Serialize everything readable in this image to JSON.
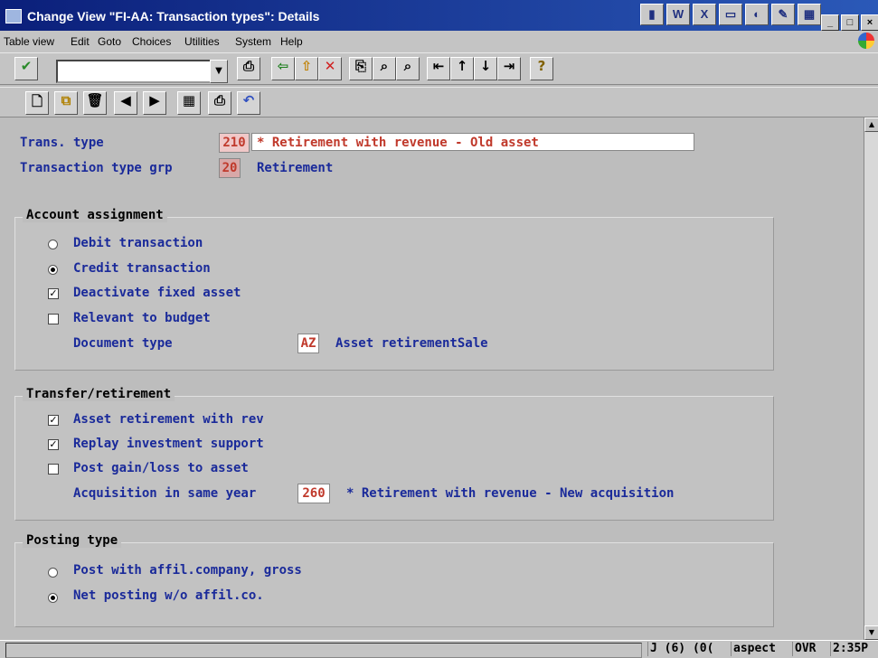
{
  "window": {
    "title": "Change View \"FI-AA: Transaction types\": Details"
  },
  "menu": [
    "Table view",
    "Edit",
    "Goto",
    "Choices",
    "Utilities",
    "System",
    "Help"
  ],
  "header": {
    "trans_type_label": "Trans. type",
    "trans_type_code": "210",
    "trans_type_desc": "* Retirement with revenue - Old asset",
    "group_label": "Transaction type grp",
    "group_code": "20",
    "group_desc": "Retirement"
  },
  "account_assignment": {
    "title": "Account assignment",
    "debit": {
      "label": "Debit transaction",
      "selected": false
    },
    "credit": {
      "label": "Credit transaction",
      "selected": true
    },
    "deactivate": {
      "label": "Deactivate fixed asset",
      "checked": true
    },
    "budget": {
      "label": "Relevant to budget",
      "checked": false
    },
    "doc_type_label": "Document type",
    "doc_type_code": "AZ",
    "doc_type_desc": "Asset retirementSale"
  },
  "transfer_retirement": {
    "title": "Transfer/retirement",
    "asset_ret": {
      "label": "Asset retirement with rev",
      "checked": true
    },
    "replay": {
      "label": "Replay investment support",
      "checked": true
    },
    "post_gain": {
      "label": "Post gain/loss to asset",
      "checked": false
    },
    "acq_label": "Acquisition in same year",
    "acq_code": "260",
    "acq_desc": "* Retirement with revenue - New acquisition"
  },
  "posting_type": {
    "title": "Posting type",
    "gross": {
      "label": "Post with affil.company, gross",
      "selected": false
    },
    "net": {
      "label": "Net posting w/o affil.co.",
      "selected": true
    }
  },
  "status": {
    "session": "J (6) (0(",
    "client": "aspect",
    "mode": "OVR",
    "time": "2:35P"
  },
  "colors": {
    "label_blue": "#1a2a9a",
    "value_red": "#c0392b",
    "title_bar": "#0b1f7a",
    "background": "#bdbdbd"
  }
}
